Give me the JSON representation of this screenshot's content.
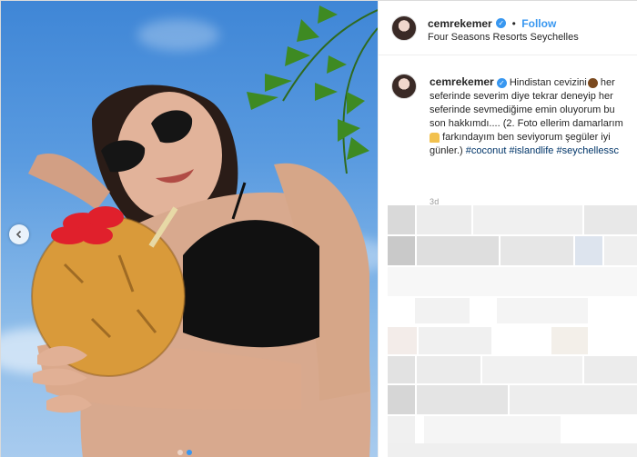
{
  "post": {
    "username": "cemrekemer",
    "follow_label": "Follow",
    "separator": "•",
    "location": "Four Seasons Resorts Seychelles",
    "caption_parts": {
      "text1": "Hindistan cevizini",
      "text2": "her seferinde severim diye tekrar deneyip her seferinde sevmediğime emin oluyorum bu son hakkımdı.... (2. Foto ellerim damarlarım",
      "text3": "farkındayım ben seviyorum şegüler iyi günler.)",
      "hashtag1": "#coconut",
      "hashtag2": "#islandlife",
      "hashtag3": "#seychellessc"
    },
    "time_ago": "3d",
    "carousel": {
      "slide_count": 2,
      "active_index": 1
    }
  },
  "icons": {
    "verified": "verified-badge-icon",
    "coconut_emoji": "coconut-emoji-icon",
    "person_emoji": "person-emoji-icon",
    "prev": "chevron-left-icon"
  },
  "colors": {
    "link": "#3897f0",
    "hashtag": "#003569",
    "text": "#262626",
    "border": "#dbdbdb"
  }
}
